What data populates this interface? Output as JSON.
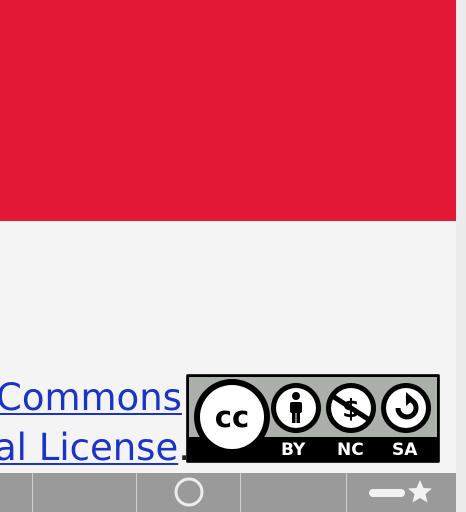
{
  "colors": {
    "banner": "#e31837",
    "link": "#1a33c8",
    "toolbar": "#9a9a9a",
    "badge_grey": "#abb1aa"
  },
  "license": {
    "line1_link": "Commons",
    "line2_link": "al License",
    "period": "."
  },
  "cc_badge": {
    "main_icon": "cc-icon",
    "icons": [
      "by-person-icon",
      "nc-dollar-icon",
      "sa-share-icon"
    ],
    "labels": {
      "by": "BY",
      "nc": "NC",
      "sa": "SA"
    }
  },
  "toolbar": {
    "items": [
      {
        "icon": "partial-tab"
      },
      {
        "icon": "blank"
      },
      {
        "icon": "circle-icon"
      },
      {
        "icon": "blank"
      },
      {
        "icon": "bookmark-star-icon"
      }
    ]
  }
}
